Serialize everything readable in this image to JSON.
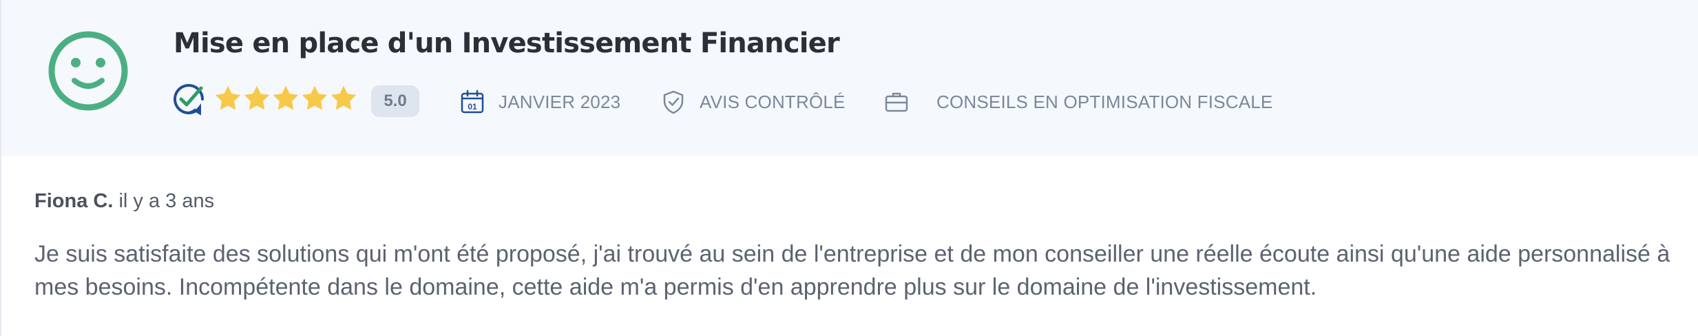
{
  "review": {
    "title": "Mise en place d'un Investissement Financier",
    "rating": {
      "stars_filled": 5,
      "stars_total": 5,
      "score_label": "5.0",
      "star_color": "#f7c948"
    },
    "date_label": "JANVIER 2023",
    "date_icon_day": "01",
    "verified_label": "AVIS CONTRÔLÉ",
    "category_label": "CONSEILS EN OPTIMISATION FISCALE",
    "icons": {
      "sentiment": "smiley-face-icon",
      "verified": "verified-check-badge-icon",
      "date": "calendar-icon",
      "verified_badge": "shield-check-icon",
      "category": "briefcase-icon"
    },
    "colors": {
      "smiley": "#4caf82",
      "verified_blue": "#1f4e96",
      "verified_green": "#2e9b6a",
      "header_bg": "#f5f8fd",
      "meta_text": "#7b889b"
    },
    "author": {
      "name": "Fiona C.",
      "time_ago": "il y a 3 ans"
    },
    "text": "Je suis satisfaite des solutions qui m'ont été proposé, j'ai trouvé au sein de l'entreprise et de mon conseiller une réelle écoute ainsi qu'une aide personnalisé à mes besoins. Incompétente dans le domaine, cette aide m'a permis d'en apprendre plus sur le domaine de l'investissement."
  }
}
